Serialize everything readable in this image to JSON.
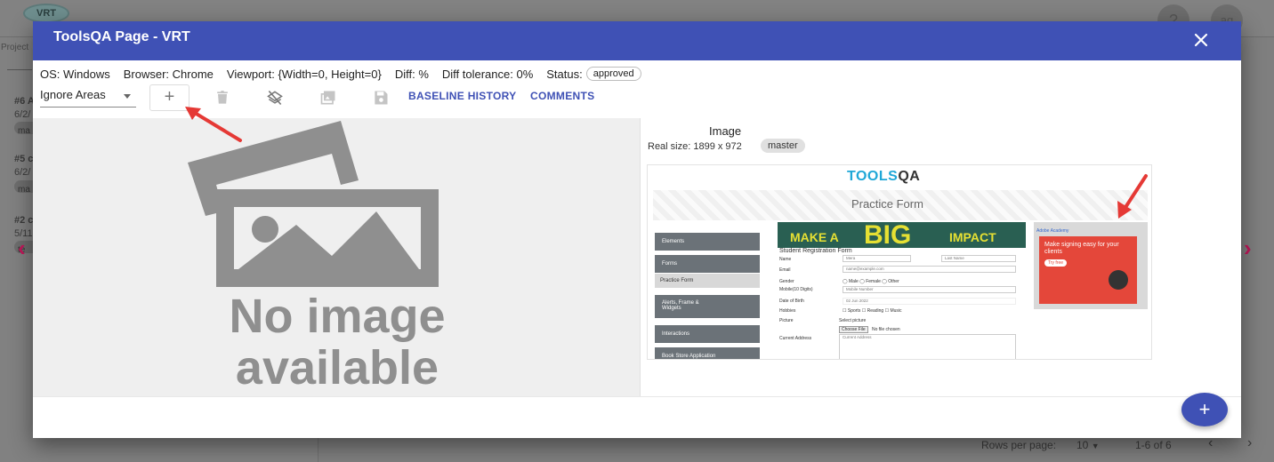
{
  "background": {
    "logo_text": "VRT",
    "help_icon": "?",
    "user_initials": "ag",
    "sidebar_label": "Project",
    "items": [
      {
        "title": "#6 A",
        "date": "6/2/",
        "chip": "ma"
      },
      {
        "title": "#5 c",
        "date": "6/2/",
        "chip": "ma"
      },
      {
        "title": "#2 c",
        "date": "5/11",
        "chip": "te"
      }
    ],
    "rows_per_page_label": "Rows per page:",
    "rows_per_page_value": "10",
    "pagination_text": "1-6 of 6"
  },
  "modal": {
    "title": "ToolsQA Page - VRT",
    "info": {
      "os": "OS: Windows",
      "browser": "Browser: Chrome",
      "viewport": "Viewport: {Width=0, Height=0}",
      "diff": "Diff: %",
      "diff_tolerance": "Diff tolerance: 0%",
      "status_label": "Status:",
      "status_value": "approved"
    },
    "toolbar": {
      "ignore_areas_label": "Ignore Areas",
      "add_label": "+",
      "baseline_history_label": "BASELINE HISTORY",
      "comments_label": "COMMENTS"
    },
    "left_pane": {
      "no_image_line1": "No image",
      "no_image_line2": "available"
    },
    "right_pane": {
      "heading": "Image",
      "real_size": "Real size: 1899 x 972",
      "branch": "master"
    },
    "screenshot": {
      "logo_part1": "TOOLS",
      "logo_part2": "QA",
      "page_heading": "Practice Form",
      "nav_elements": "Elements",
      "nav_forms": "Forms",
      "nav_practice_form": "Practice Form",
      "nav_alerts_line1": "Alerts, Frame &",
      "nav_alerts_line2": "Widgets",
      "nav_interactions": "Interactions",
      "nav_book_store": "Book Store Application",
      "banner_make": "MAKE A",
      "banner_big": "BIG",
      "banner_impact": "IMPACT",
      "form_title": "Student Registration Form",
      "label_name": "Name",
      "first_name_value": "Mera",
      "last_name_placeholder": "Last Name",
      "label_email": "Email",
      "email_placeholder": "name@example.com",
      "label_gender": "Gender",
      "gender_options": "◯ Male   ◯ Female   ◯ Other",
      "label_mobile": "Mobile(10 Digits)",
      "mobile_placeholder": "Mobile Number",
      "label_dob": "Date of Birth",
      "dob_value": "02 Jun 2022",
      "label_hobbies": "Hobbies",
      "hobbies_options": "☐ Sports   ☐ Reading   ☐ Music",
      "label_picture": "Picture",
      "select_picture": "Select picture",
      "choose_file": "Choose File",
      "no_file": "No file chosen",
      "label_address": "Current Address",
      "address_placeholder": "Current Address",
      "ad_alt": "Adobe Academy",
      "ad_text": "Make signing easy for your clients",
      "ad_button": "Try free"
    },
    "fab_label": "+"
  },
  "colors": {
    "header_blue": "#3f51b5",
    "overlay_gray": "#7f7f7f",
    "annotation_red": "#e53935",
    "arrow_pink": "#c2185b"
  }
}
